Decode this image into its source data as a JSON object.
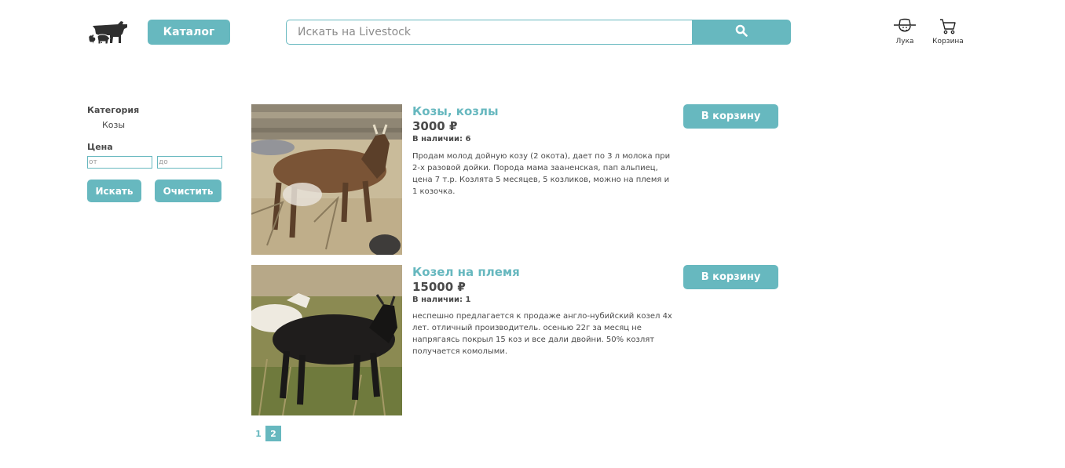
{
  "header": {
    "catalog_label": "Каталог",
    "search_placeholder": "Искать на Livestock",
    "user_label": "Лука",
    "cart_label": "Корзина"
  },
  "sidebar": {
    "category_label": "Категория",
    "category_value": "Козы",
    "price_label": "Цена",
    "price_from_placeholder": "от",
    "price_to_placeholder": "до",
    "search_label": "Искать",
    "clear_label": "Очистить"
  },
  "products": [
    {
      "title": "Козы, козлы",
      "price": "3000 ₽",
      "stock": "В наличии: 6",
      "description": "Продам молод дойную козу (2 окота), дает по 3 л молока при 2-х разовой дойки. Порода мама зааненская, пап альпиец, цена 7 т.р. Козлята 5 месяцев, 5 козликов, можно на племя и 1 козочка.",
      "cart_label": "В корзину"
    },
    {
      "title": "Козел на племя",
      "price": "15000 ₽",
      "stock": "В наличии: 1",
      "description": "неспешно предлагается к продаже англо-нубийский козел 4х лет. отличный производитель. осенью 22г за месяц не напрягаясь покрыл 15 коз и все дали двойни. 50% козлят получается комолыми.",
      "cart_label": "В корзину"
    }
  ],
  "pagination": {
    "pages": [
      "1",
      "2"
    ],
    "current": "2"
  },
  "colors": {
    "accent": "#67b8bf",
    "text": "#4a4a4a"
  },
  "icons": {
    "logo": "farm-animals-logo-icon",
    "search": "magnifier-icon",
    "user": "farmer-hat-icon",
    "cart": "cart-icon"
  }
}
